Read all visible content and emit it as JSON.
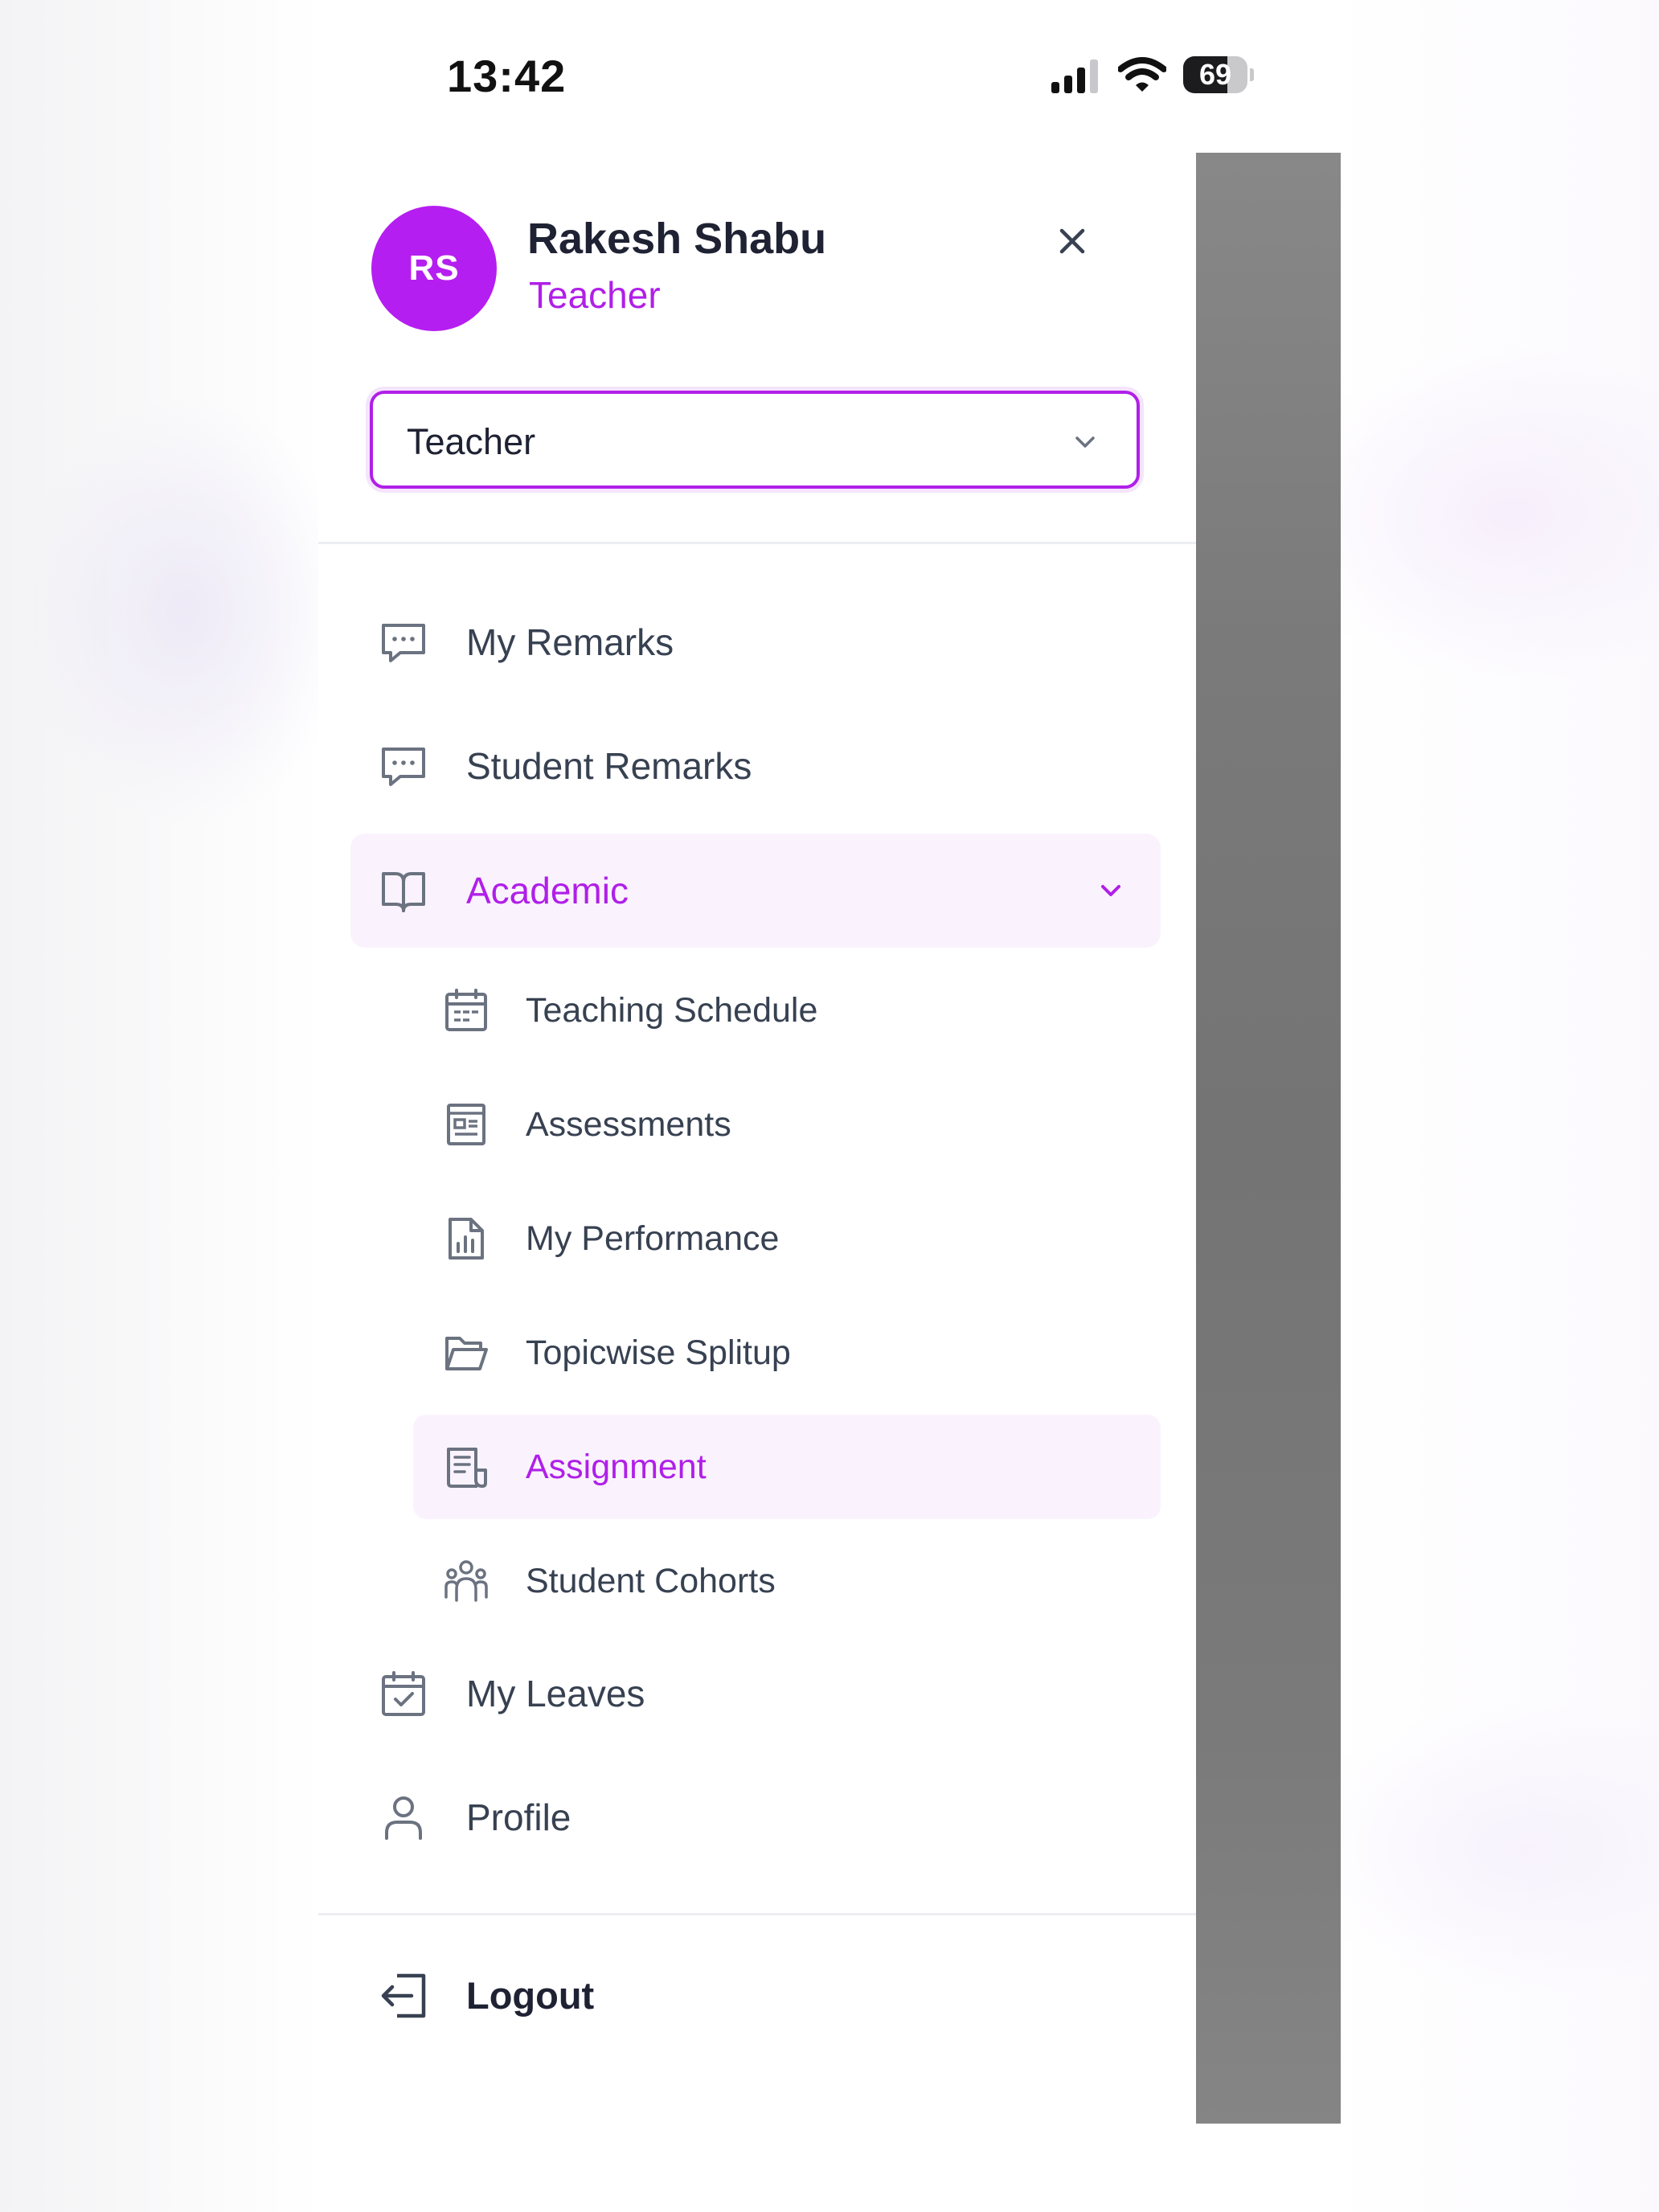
{
  "status_bar": {
    "time": "13:42",
    "battery_level": "69",
    "icons": [
      "signal-icon",
      "wifi-icon",
      "battery-icon"
    ]
  },
  "user": {
    "initials": "RS",
    "name": "Rakesh Shabu",
    "role": "Teacher",
    "avatar_color": "#b51ef0"
  },
  "role_select": {
    "value": "Teacher",
    "icon": "chevron-down-icon"
  },
  "menu": {
    "my_remarks": {
      "label": "My Remarks",
      "icon": "chat-bubble-icon"
    },
    "student_remarks": {
      "label": "Student Remarks",
      "icon": "chat-bubble-icon"
    },
    "academic": {
      "label": "Academic",
      "icon": "book-open-icon",
      "expanded": true,
      "children": [
        {
          "label": "Teaching Schedule",
          "icon": "calendar-icon"
        },
        {
          "label": "Assessments",
          "icon": "newspaper-icon"
        },
        {
          "label": "My Performance",
          "icon": "document-chart-icon"
        },
        {
          "label": "Topicwise Splitup",
          "icon": "folder-open-icon"
        },
        {
          "label": "Assignment",
          "icon": "document-text-icon",
          "active": true
        },
        {
          "label": "Student Cohorts",
          "icon": "user-group-icon"
        }
      ]
    },
    "my_leaves": {
      "label": "My Leaves",
      "icon": "calendar-check-icon"
    },
    "profile": {
      "label": "Profile",
      "icon": "user-icon"
    }
  },
  "logout": {
    "label": "Logout",
    "icon": "logout-icon"
  },
  "colors": {
    "accent": "#b01fe8",
    "active_background": "#faf3fd",
    "text": "#374151",
    "overlay": "#777777"
  }
}
